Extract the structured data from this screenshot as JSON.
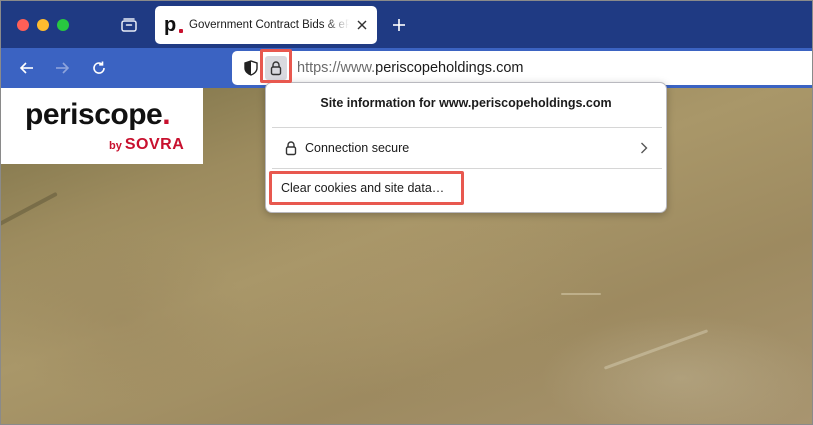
{
  "browser": {
    "tab": {
      "title": "Government Contract Bids & eP",
      "favicon_letter": "p"
    },
    "address_bar": {
      "url_prefix": "https://www.",
      "url_domain": "periscopeholdings.com"
    }
  },
  "page": {
    "logo": {
      "main": "periscope",
      "main_dot": ".",
      "sub_by": "by",
      "sub_brand": "SOVRA"
    }
  },
  "site_info_popup": {
    "title": "Site information for www.periscopeholdings.com",
    "connection_label": "Connection secure",
    "clear_button": "Clear cookies and site data…"
  },
  "colors": {
    "tabstrip": "#1f3a83",
    "toolbar": "#3b63c2",
    "brand_red": "#c8102e",
    "highlight": "#e8584f"
  },
  "icons": [
    "tab-overview-icon",
    "close-icon",
    "plus-icon",
    "back-arrow-icon",
    "forward-arrow-icon",
    "reload-icon",
    "shield-icon",
    "lock-icon",
    "chevron-right-icon"
  ]
}
